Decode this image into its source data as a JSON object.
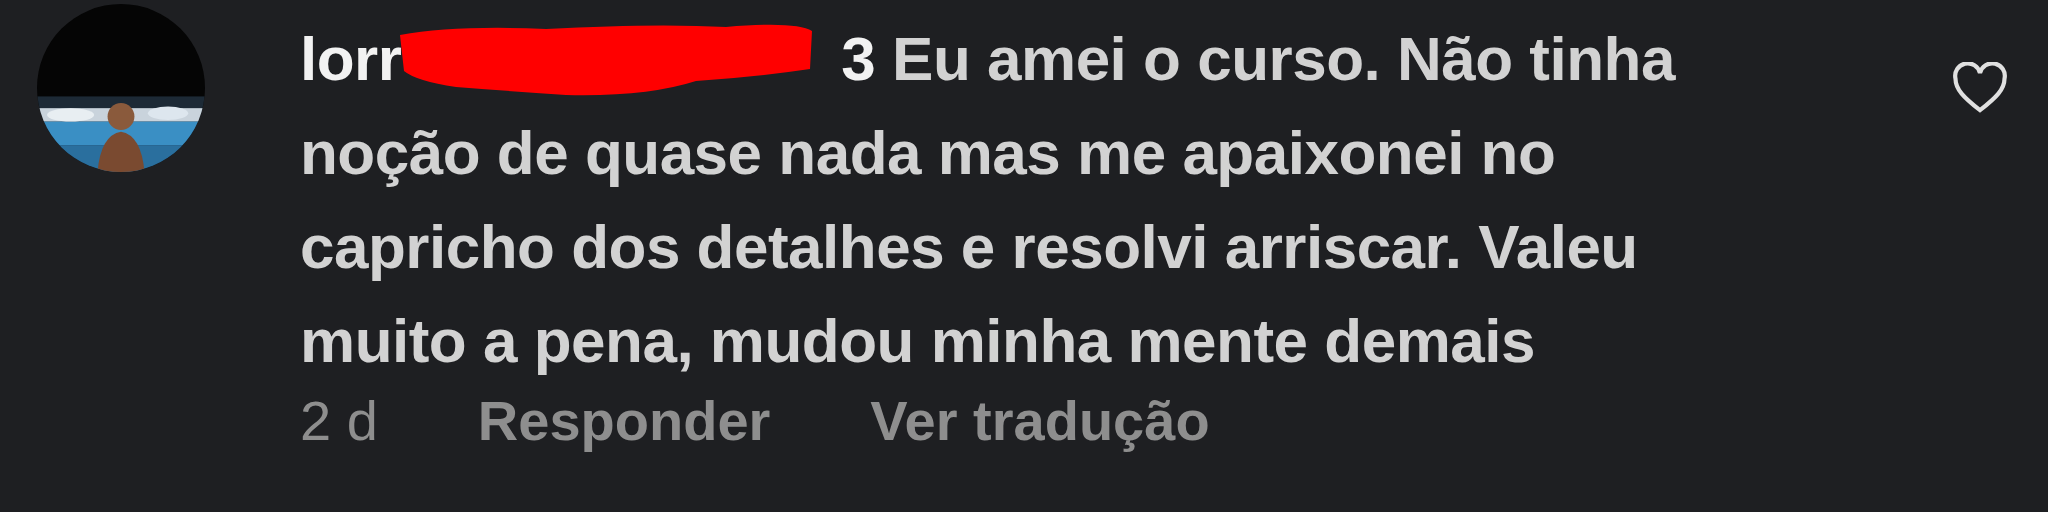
{
  "comment": {
    "username_parts": [
      "lorr",
      "3"
    ],
    "redacted": true,
    "text": "Eu amei o curso. Não tinha noção de quase nada mas me apaixonei no capricho dos detalhes e resolvi arriscar. Valeu muito a pena, mudou minha mente demais",
    "liked": false,
    "time": "2 d",
    "actions": [
      "Responder",
      "Ver tradução"
    ]
  }
}
